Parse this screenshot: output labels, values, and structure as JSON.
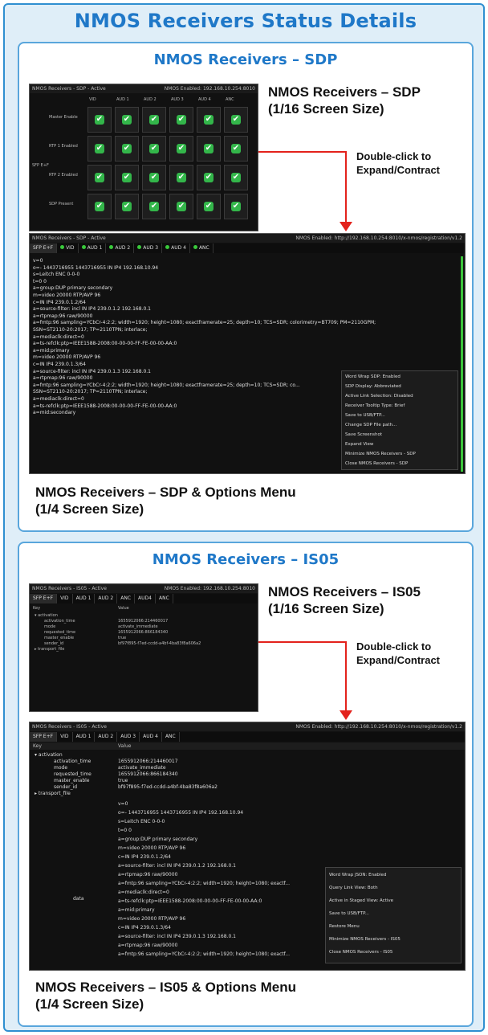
{
  "page_title": "NMOS Receivers Status Details",
  "sdp_section": {
    "title": "NMOS Receivers – SDP",
    "small_label_line1": "NMOS Receivers – SDP",
    "small_label_line2": "(1/16 Screen Size)",
    "dbl_click_line1": "Double-click to",
    "dbl_click_line2": "Expand/Contract",
    "large_label_line1": "NMOS Receivers – SDP & Options Menu",
    "large_label_line2": "(1/4 Screen Size)",
    "small_shot": {
      "header_left": "NMOS Receivers - SDP - Active",
      "header_right": "NMOS Enabled: 192.168.10.254:8010",
      "columns": [
        "VID",
        "AUD 1",
        "AUD 2",
        "AUD 3",
        "AUD 4",
        "ANC"
      ],
      "rows": [
        "Master Enable",
        "RTP 1 Enabled",
        "RTP 2 Enabled",
        "SDP Present"
      ],
      "group_label": "SFP E+F"
    },
    "large_shot": {
      "header_left": "NMOS Receivers - SDP - Active",
      "header_right": "NMOS Enabled: http://192.168.10.254:8010/x-nmos/registration/v1.2",
      "tabs": [
        "SFP E+F",
        "VID",
        "AUD 1",
        "AUD 2",
        "AUD 3",
        "AUD 4",
        "ANC"
      ],
      "sdp_lines": [
        "v=0",
        "o=- 1443716955 1443716955 IN IP4 192.168.10.94",
        "s=Leitch ENC 0-0-0",
        "t=0 0",
        "a=group:DUP primary secondary",
        "m=video 20000 RTP/AVP 96",
        "c=IN IP4 239.0.1.2/64",
        "a=source-filter: incl IN IP4 239.0.1.2 192.168.0.1",
        "a=rtpmap:96 raw/90000",
        "a=fmtp:96 sampling=YCbCr-4:2:2; width=1920; height=1080; exactframerate=25; depth=10; TCS=SDR; colorimetry=BT709; PM=2110GPM;",
        "SSN=ST2110-20:2017; TP=2110TPN; interlace;",
        "a=mediaclk:direct=0",
        "a=ts-refclk:ptp=IEEE1588-2008:00-00-00-FF-FE-00-00-AA:0",
        "a=mid:primary",
        "m=video 20000 RTP/AVP 96",
        "c=IN IP4 239.0.1.3/64",
        "a=source-filter: incl IN IP4 239.0.1.3 192.168.0.1",
        "a=rtpmap:96 raw/90000",
        "a=fmtp:96 sampling=YCbCr-4:2:2; width=1920; height=1080; exactframerate=25; depth=10; TCS=SDR; co...",
        "SSN=ST2110-20:2017; TP=2110TPN; interlace;",
        "a=mediaclk:direct=0",
        "a=ts-refclk:ptp=IEEE1588-2008:00-00-00-FF-FE-00-00-AA:0",
        "a=mid:secondary"
      ],
      "menu_items": [
        "Word Wrap SDP:      Enabled",
        "SDP Display:        Abbreviated",
        "Active Link Selection: Disabled",
        "Receiver Tooltip Type: Brief",
        "Save to USB/FTP...",
        "Change SDP File path...",
        "Save Screenshot",
        "Expand View",
        "Minimize NMOS Receivers - SDP",
        "Close NMOS Receivers - SDP"
      ]
    }
  },
  "is05_section": {
    "title": "NMOS Receivers – IS05",
    "small_label_line1": "NMOS Receivers – IS05",
    "small_label_line2": "(1/16 Screen Size)",
    "dbl_click_line1": "Double-click to",
    "dbl_click_line2": "Expand/Contract",
    "large_label_line1": "NMOS Receivers – IS05 & Options Menu",
    "large_label_line2": "(1/4 Screen Size)",
    "small_shot": {
      "header_left": "NMOS Receivers - IS05 - Active",
      "header_right": "NMOS Enabled: 192.168.10.254:8010",
      "tabs": [
        "SFP E+F",
        "VID",
        "AUD 1",
        "AUD 2",
        "ANC",
        "AUD4",
        "ANC"
      ],
      "col_key": "Key",
      "col_value": "Value"
    },
    "large_shot": {
      "header_left": "NMOS Receivers - IS05 - Active",
      "header_right": "NMOS Enabled: http://192.168.10.254:8010/x-nmos/registration/v1.2",
      "tabs": [
        "SFP E+F",
        "VID",
        "AUD 1",
        "AUD 2",
        "AUD 3",
        "AUD 4",
        "ANC"
      ],
      "col_key": "Key",
      "col_value": "Value",
      "tree": [
        {
          "key": "▾ activation",
          "value": ""
        },
        {
          "key": "activation_time",
          "value": "1655912066:214460017"
        },
        {
          "key": "mode",
          "value": "activate_immediate"
        },
        {
          "key": "requested_time",
          "value": "1655912066:866184340"
        },
        {
          "key": "master_enable",
          "value": "true"
        },
        {
          "key": "sender_id",
          "value": "bf97f895-f7ed-ccdd-a4bf-4ba83f8a606a2"
        },
        {
          "key": "▸ transport_file",
          "value": ""
        }
      ],
      "sdp_lines": [
        "v=0",
        "o=- 1443716955 1443716955 IN IP4 192.168.10.94",
        "s=Leitch ENC 0-0-0",
        "t=0 0",
        "a=group:DUP primary secondary",
        "m=video 20000 RTP/AVP 96",
        "c=IN IP4 239.0.1.2/64",
        "a=source-filter: incl IN IP4 239.0.1.2 192.168.0.1",
        "a=rtpmap:96 raw/90000",
        "a=fmtp:96 sampling=YCbCr-4:2:2; width=1920; height=1080; exactf...",
        "a=mediaclk:direct=0",
        "a=ts-refclk:ptp=IEEE1588-2008:00-00-00-FF-FE-00-00-AA:0",
        "a=mid:primary",
        "m=video 20000 RTP/AVP 96",
        "c=IN IP4 239.0.1.3/64",
        "a=source-filter: incl IN IP4 239.0.1.3 192.168.0.1",
        "a=rtpmap:96 raw/90000",
        "a=fmtp:96 sampling=YCbCr-4:2:2; width=1920; height=1080; exactf..."
      ],
      "data_key": "data",
      "menu_items": [
        "Word Wrap JSON:       Enabled",
        "Query Link View:      Both",
        "Active in Staged View: Active",
        "Save to USB/FTP...",
        "Restore Menu",
        "Minimize NMOS Receivers - IS05",
        "Close NMOS Receivers - IS05"
      ]
    }
  },
  "colors": {
    "accent_blue": "#1f78c8",
    "arrow_red": "#e3221c",
    "status_green": "#33b64a"
  }
}
